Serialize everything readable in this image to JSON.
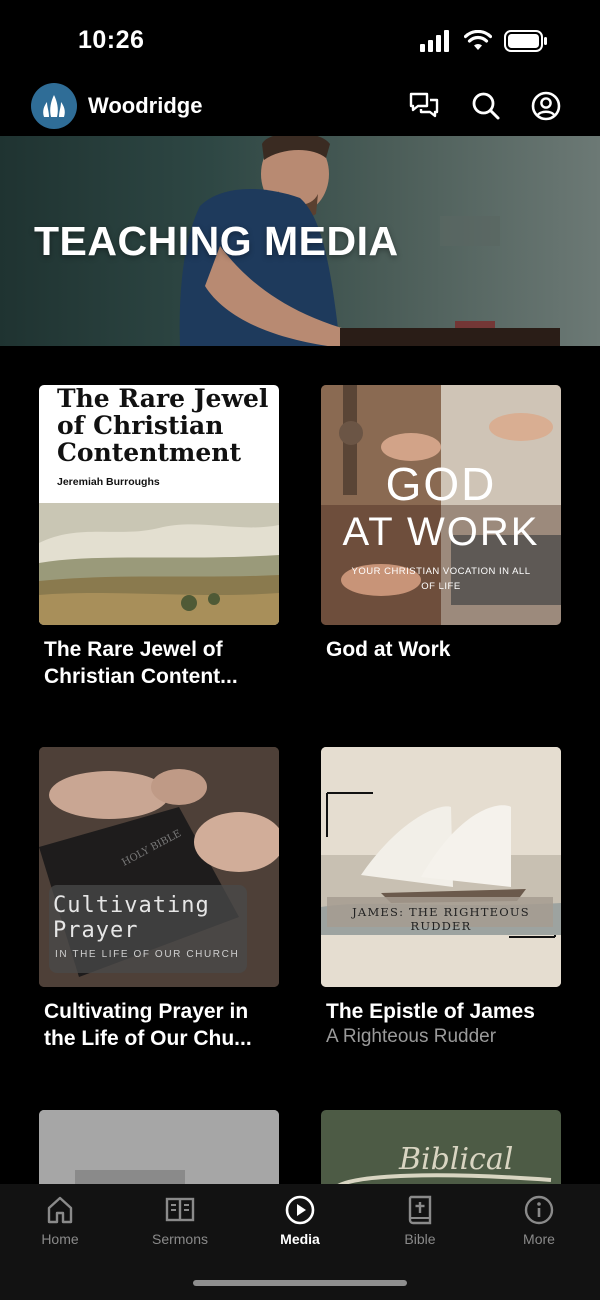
{
  "status_bar": {
    "time": "10:26"
  },
  "header": {
    "org_name": "Woodridge"
  },
  "hero": {
    "title": "TEACHING MEDIA"
  },
  "media": [
    {
      "title": "The Rare Jewel of Christian Content...",
      "subtitle": "",
      "art_title": [
        "The Rare Jewel",
        "of Christian",
        "Contentment"
      ],
      "art_author": "Jeremiah Burroughs"
    },
    {
      "title": "God at Work",
      "subtitle": "",
      "art_title": [
        "GOD",
        "AT WORK"
      ],
      "art_tagline": "YOUR CHRISTIAN VOCATION IN ALL",
      "art_tagline2": "OF LIFE"
    },
    {
      "title": "Cultivating Prayer in the Life of Our Chu...",
      "subtitle": "",
      "art_title": [
        "Cultivating",
        "Prayer"
      ],
      "art_tagline": "IN THE LIFE OF OUR CHURCH",
      "art_book": "HOLY BIBLE"
    },
    {
      "title": "The Epistle of James",
      "subtitle": "A Righteous Rudder",
      "art_banner": "JAMES: THE RIGHTEOUS RUDDER"
    },
    {
      "title": "",
      "subtitle": ""
    },
    {
      "title": "",
      "subtitle": "",
      "art_title": [
        "Biblical"
      ]
    }
  ],
  "tabs": [
    {
      "label": "Home",
      "icon": "home-icon",
      "active": false
    },
    {
      "label": "Sermons",
      "icon": "book-open-icon",
      "active": false
    },
    {
      "label": "Media",
      "icon": "play-circle-icon",
      "active": true
    },
    {
      "label": "Bible",
      "icon": "bible-icon",
      "active": false
    },
    {
      "label": "More",
      "icon": "info-icon",
      "active": false
    }
  ],
  "colors": {
    "background": "#000000",
    "tab_bar": "#121212",
    "logo": "#2f6d97",
    "inactive": "#8a8a8a"
  }
}
